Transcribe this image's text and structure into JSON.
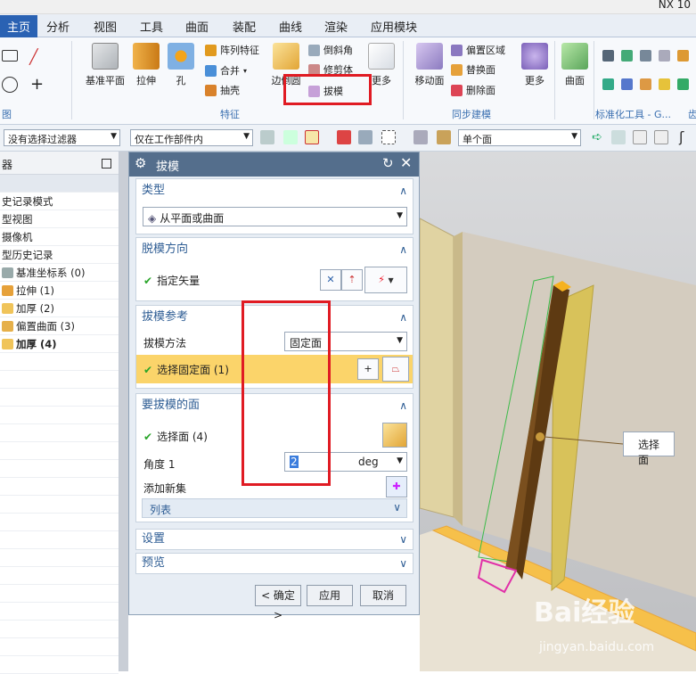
{
  "window": {
    "title": "NX 10"
  },
  "tabs": [
    "主页",
    "分析",
    "视图",
    "工具",
    "曲面",
    "装配",
    "曲线",
    "渲染",
    "应用模块"
  ],
  "ribbon": {
    "large_buttons": {
      "datum_plane": "基准平面",
      "extrude": "拉伸",
      "hole": "孔",
      "edge_blend": "边倒圆",
      "more1": "更多",
      "move_face": "移动面",
      "more2": "更多",
      "surface": "曲面"
    },
    "small_buttons": {
      "pattern": "阵列特征",
      "unite": "合并",
      "shell": "抽壳",
      "chamfer": "倒斜角",
      "trim_body": "修剪体",
      "draft": "拔模",
      "offset_region": "偏置区域",
      "replace_face": "替换面",
      "delete_face": "删除面"
    },
    "groups": {
      "direct": "图",
      "feature": "特征",
      "sync": "同步建模",
      "std": "标准化工具 - G...",
      "gear": "齿"
    }
  },
  "filterbar": {
    "type_filter": "没有选择过滤器",
    "scope": "仅在工作部件内",
    "face_rule": "单个面"
  },
  "navigator": {
    "header": "器",
    "rows": [
      "史记录模式",
      "型视图",
      "摄像机",
      "型历史记录",
      "基准坐标系 (0)",
      "拉伸 (1)",
      "加厚 (2)",
      "偏置曲面 (3)",
      "加厚 (4)"
    ]
  },
  "dialog": {
    "title": "拔模",
    "type": {
      "header": "类型",
      "value": "从平面或曲面"
    },
    "direction": {
      "header": "脱模方向",
      "specify_vector": "指定矢量"
    },
    "reference": {
      "header": "拔模参考",
      "method_label": "拔模方法",
      "method_value": "固定面",
      "select_fixed": "选择固定面 (1)"
    },
    "faces": {
      "header": "要拔模的面",
      "select_face": "选择面 (4)",
      "angle_label": "角度 1",
      "angle_value": "2",
      "angle_unit": "deg",
      "add_set": "添加新集",
      "list": "列表"
    },
    "settings": {
      "header": "设置"
    },
    "preview": {
      "header": "预览"
    },
    "buttons": {
      "ok": "< 确定 >",
      "apply": "应用",
      "cancel": "取消"
    }
  },
  "viewport": {
    "tooltip": "选择面"
  },
  "watermark": {
    "brand": "Bai经验",
    "url": "jingyan.baidu.com"
  },
  "colors": {
    "tab_active": "#2a62b3",
    "dialog_title": "#546e8c",
    "highlight": "#fbd46a",
    "annotation": "#e01b23"
  }
}
